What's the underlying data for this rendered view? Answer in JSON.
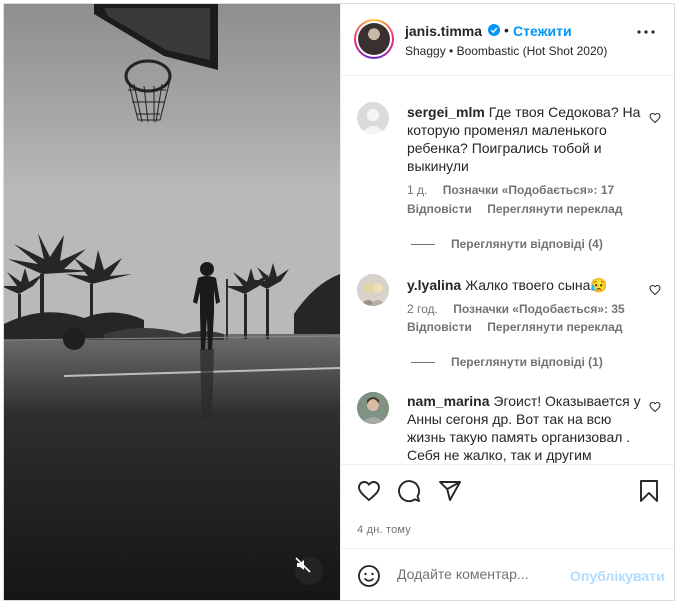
{
  "post": {
    "author": "janis.timma",
    "follow_label": "Стежити",
    "separator": "•",
    "song": "Shaggy • Boombastic (Hot Shot 2020)",
    "date": "4 дн. тому"
  },
  "comments": [
    {
      "user": "sergei_mlm",
      "text": "Где твоя Седокова? На которую променял маленького ребенка? Поигрались тобой и выкинули",
      "time": "1 д.",
      "likes": "Позначки «Подобається»: 17",
      "reply_label": "Відповісти",
      "translate_label": "Переглянути переклад",
      "view_replies": "Переглянути відповіді (4)"
    },
    {
      "user": "y.lyalina",
      "text": "Жалко твоего сына😥",
      "time": "2 год.",
      "likes": "Позначки «Подобається»: 35",
      "reply_label": "Відповісти",
      "translate_label": "Переглянути переклад",
      "view_replies": "Переглянути відповіді (1)"
    },
    {
      "user": "nam_marina",
      "text": "Эгоист! Оказывается у Анны сегоня др. Вот так на всю жизнь такую память организовал . Себя не жалко, так и другим"
    }
  ],
  "compose": {
    "placeholder": "Додайте коментар...",
    "publish_label": "Опублікувати"
  },
  "colors": {
    "accent": "#0095f6",
    "publish_disabled": "#b3dbff",
    "secondary_text": "#737373"
  },
  "icons": [
    "verified-badge-icon",
    "more-options-icon",
    "heart-icon",
    "comment-icon",
    "share-icon",
    "bookmark-icon",
    "emoji-icon",
    "mute-icon"
  ]
}
